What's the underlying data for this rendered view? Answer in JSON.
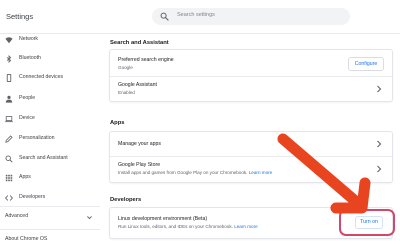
{
  "header": {
    "title": "Settings",
    "search_placeholder": "Search settings"
  },
  "sidebar": {
    "items": [
      {
        "label": "Network",
        "icon": "wifi-icon"
      },
      {
        "label": "Bluetooth",
        "icon": "bluetooth-icon"
      },
      {
        "label": "Connected devices",
        "icon": "phone-icon"
      },
      {
        "label": "People",
        "icon": "person-icon"
      },
      {
        "label": "Device",
        "icon": "laptop-icon"
      },
      {
        "label": "Personalization",
        "icon": "pencil-icon"
      },
      {
        "label": "Search and Assistant",
        "icon": "search-icon"
      },
      {
        "label": "Apps",
        "icon": "apps-grid-icon"
      },
      {
        "label": "Developers",
        "icon": "code-icon"
      }
    ],
    "advanced_label": "Advanced",
    "about_label": "About Chrome OS"
  },
  "sections": {
    "search_assistant": {
      "title": "Search and Assistant",
      "preferred_engine": {
        "title": "Preferred search engine",
        "value": "Google",
        "button": "Configure"
      },
      "assistant": {
        "title": "Google Assistant",
        "value": "Enabled"
      }
    },
    "apps": {
      "title": "Apps",
      "manage": {
        "title": "Manage your apps"
      },
      "play_store": {
        "title": "Google Play Store",
        "desc": "Install apps and games from Google Play on your Chromebook.",
        "link": "Learn more"
      }
    },
    "developers": {
      "title": "Developers",
      "linux": {
        "title": "Linux development environment (Beta)",
        "desc": "Run Linux tools, editors, and IDEs on your Chromebook.",
        "link": "Learn more",
        "button": "Turn on"
      }
    }
  },
  "colors": {
    "accent": "#1a73e8",
    "annotation_arrow": "#e8441f",
    "annotation_highlight": "#d3476b"
  }
}
